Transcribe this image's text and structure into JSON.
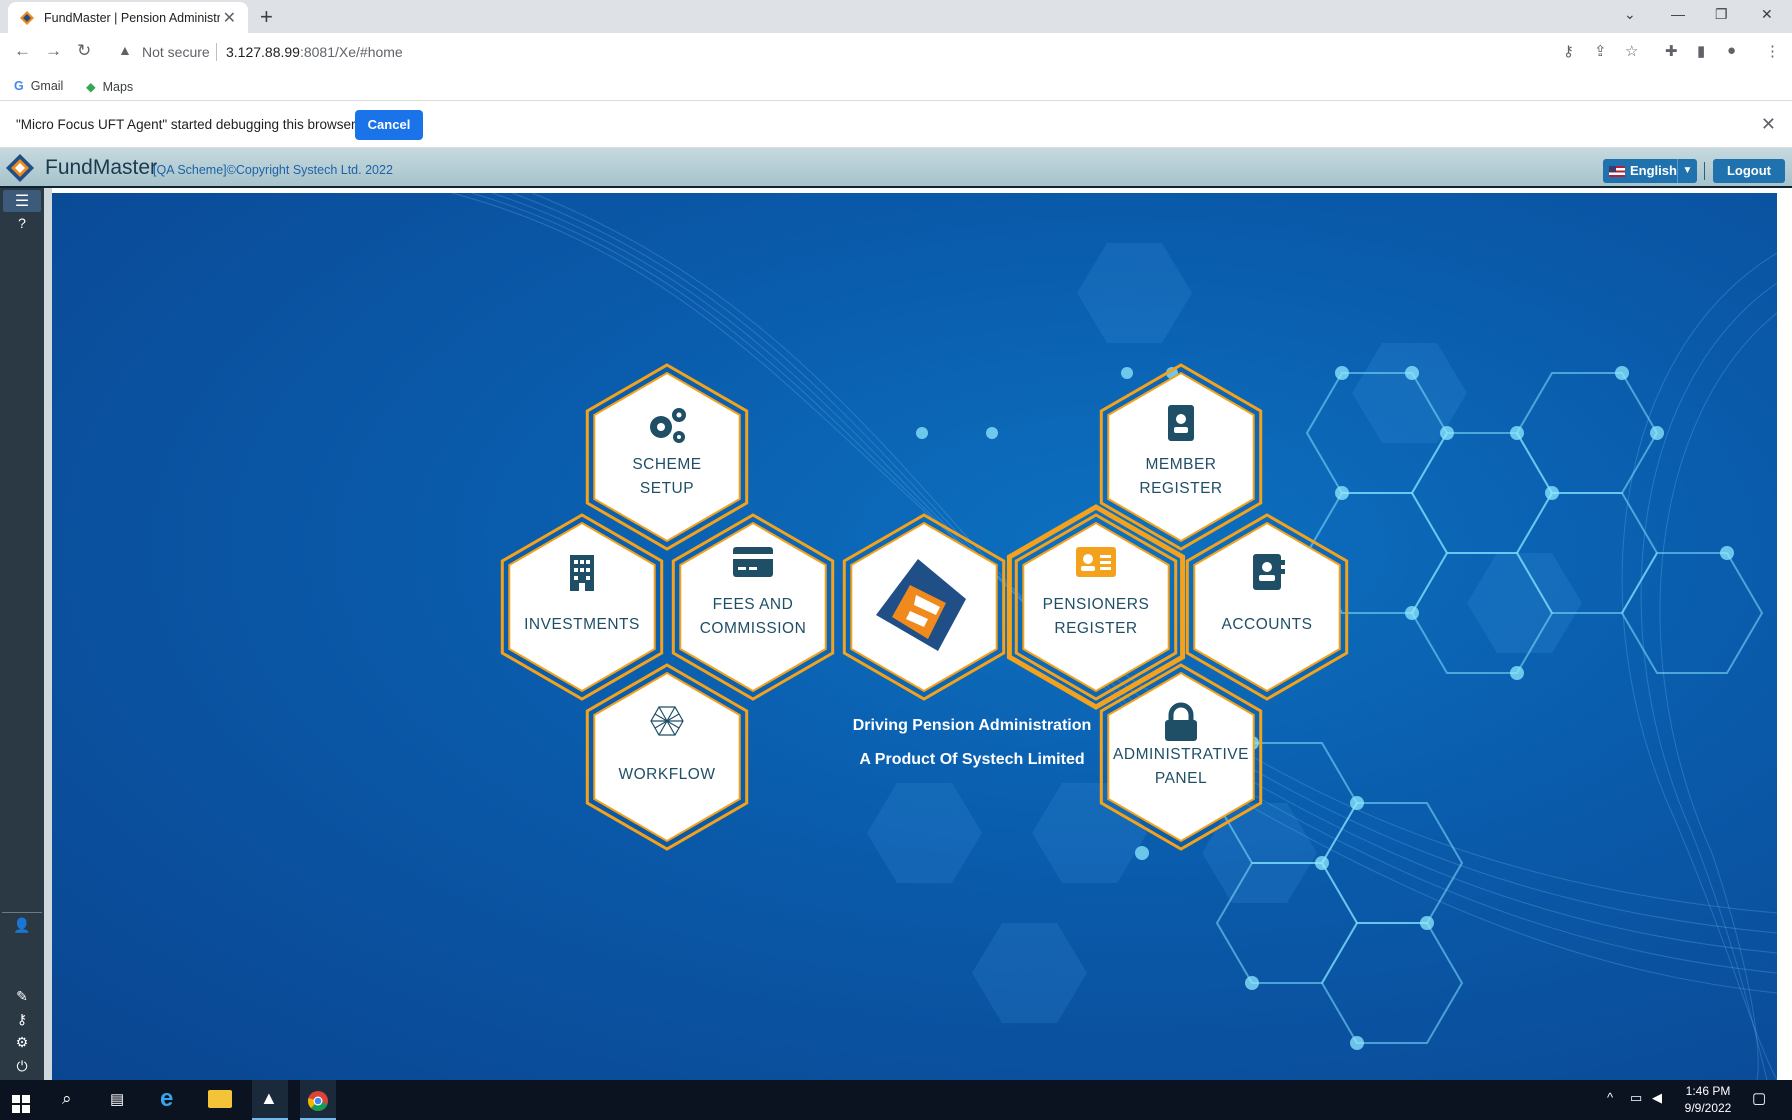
{
  "browser": {
    "tab_title": "FundMaster | Pension Administra",
    "security_label": "Not secure",
    "url_host": "3.127.88.99",
    "url_rest": ":8081/Xe/#home",
    "bookmarks": [
      "Gmail",
      "Maps"
    ]
  },
  "infobar": {
    "message": "\"Micro Focus UFT Agent\" started debugging this browser",
    "cancel_label": "Cancel"
  },
  "header": {
    "brand": "FundMaster",
    "copyright": "[QA Scheme]©Copyright Systech Ltd. 2022",
    "language": "English",
    "logout_label": "Logout"
  },
  "tiles": {
    "scheme_setup": [
      "SCHEME",
      "SETUP"
    ],
    "member_register": [
      "MEMBER",
      "REGISTER"
    ],
    "investments": [
      "INVESTMENTS"
    ],
    "fees_commission": [
      "FEES AND",
      "COMMISSION"
    ],
    "pensioners_register": [
      "PENSIONERS",
      "REGISTER"
    ],
    "accounts": [
      "ACCOUNTS"
    ],
    "workflow": [
      "WORKFLOW"
    ],
    "administrative_panel": [
      "ADMINISTRATIVE",
      "PANEL"
    ]
  },
  "tagline": {
    "line1": "Driving Pension Administration",
    "line2": "A Product Of Systech Limited"
  },
  "taskbar": {
    "time": "1:46 PM",
    "date": "9/9/2022"
  },
  "colors": {
    "accent_orange": "#f4a21c",
    "header_blue": "#1f72ad",
    "sidebar": "#2b3945",
    "tile_text": "#1f4f66"
  }
}
